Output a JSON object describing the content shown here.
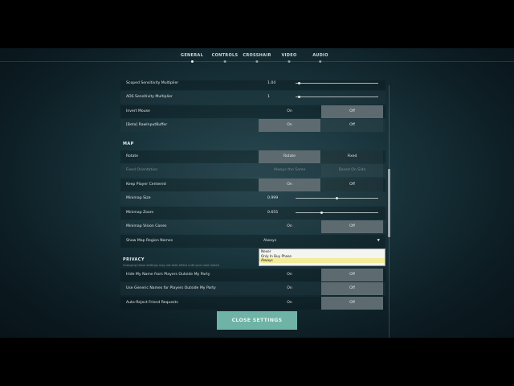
{
  "nav": {
    "tabs": [
      {
        "label": "GENERAL",
        "active": true
      },
      {
        "label": "CONTROLS",
        "active": false
      },
      {
        "label": "CROSSHAIR",
        "active": false
      },
      {
        "label": "VIDEO",
        "active": false
      },
      {
        "label": "AUDIO",
        "active": false
      }
    ]
  },
  "general": {
    "scoped_sensitivity": {
      "label": "Scoped Sensitivity Multiplier",
      "value": "1.04",
      "fraction": 0.03
    },
    "ads_sensitivity": {
      "label": "ADS Sensitivity Multiplier",
      "value": "1",
      "fraction": 0.03
    },
    "invert_mouse": {
      "label": "Invert Mouse",
      "on": "On",
      "off": "Off",
      "selected": "Off"
    },
    "raw_input_buffer": {
      "label": "[Beta] RawInputBuffer",
      "on": "On",
      "off": "Off",
      "selected": "On"
    }
  },
  "map": {
    "heading": "MAP",
    "rotate": {
      "label": "Rotate",
      "opt_a": "Rotate",
      "opt_b": "Fixed",
      "selected": "Rotate"
    },
    "fixed_orientation": {
      "label": "Fixed Orientation",
      "opt_a": "Always the Same",
      "opt_b": "Based On Side"
    },
    "keep_player_centered": {
      "label": "Keep Player Centered",
      "on": "On",
      "off": "Off",
      "selected": "On"
    },
    "minimap_size": {
      "label": "Minimap Size",
      "value": "0.999",
      "fraction": 0.5
    },
    "minimap_zoom": {
      "label": "Minimap Zoom",
      "value": "0.655",
      "fraction": 0.3
    },
    "minimap_vision_cones": {
      "label": "Minimap Vision Cones",
      "on": "On",
      "off": "Off",
      "selected": "Off"
    },
    "show_map_region_names": {
      "label": "Show Map Region Names",
      "value": "Always",
      "arrow": "▼",
      "options": [
        "Never",
        "Only In Buy Phase",
        "Always"
      ],
      "highlighted": "Always"
    }
  },
  "privacy": {
    "heading": "PRIVACY",
    "note": "Changing these settings may not take effect until your next match",
    "hide_name": {
      "label": "Hide My Name from Players Outside My Party",
      "on": "On",
      "off": "Off",
      "selected": "Off"
    },
    "generic_names": {
      "label": "Use Generic Names for Players Outside My Party",
      "on": "On",
      "off": "Off",
      "selected": "Off"
    },
    "auto_reject": {
      "label": "Auto-Reject Friend Requests",
      "on": "On",
      "off": "Off",
      "selected": "Off"
    }
  },
  "close_button": {
    "label": "CLOSE SETTINGS"
  },
  "colors": {
    "accent": "#6fb3a6",
    "selected_option": "#5d6b70",
    "dropdown_highlight": "#f3ec9a"
  }
}
